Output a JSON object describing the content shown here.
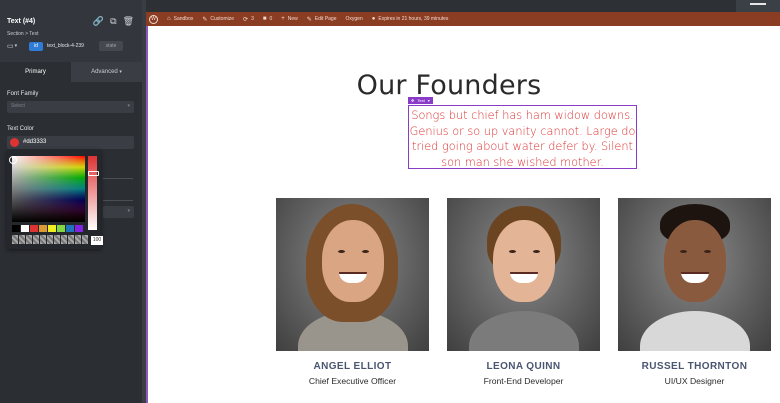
{
  "panel": {
    "element_title": "Text (#4)",
    "breadcrumb": "Section > Text",
    "device_icon": "monitor-icon",
    "id_badge": "id",
    "selector_name": "text_block-4-239",
    "state_label": "state",
    "tabs": {
      "primary": "Primary",
      "advanced": "Advanced"
    },
    "font_family": {
      "label": "Font Family",
      "placeholder": "Select"
    },
    "text_color": {
      "label": "Text Color",
      "value": "#dd3333"
    },
    "alpha_value": "100",
    "preset_colors": [
      "#000000",
      "#ffffff",
      "#dd3333",
      "#dd9933",
      "#eeee22",
      "#81d742",
      "#1e73be",
      "#8224e3"
    ]
  },
  "adminbar": {
    "items": [
      {
        "icon": "wordpress-icon",
        "label": ""
      },
      {
        "icon": "home-icon",
        "label": "Sandbox"
      },
      {
        "icon": "brush-icon",
        "label": "Customize"
      },
      {
        "icon": "refresh-icon",
        "label": "3"
      },
      {
        "icon": "comment-icon",
        "label": "0"
      },
      {
        "icon": "plus-icon",
        "label": "New"
      },
      {
        "icon": "pencil-icon",
        "label": "Edit Page"
      },
      {
        "icon": "",
        "label": "Oxygen"
      },
      {
        "icon": "avatar-icon",
        "label": "Expires in 21 hours, 39 minutes"
      }
    ]
  },
  "content": {
    "title": "Our Founders",
    "text_badge": "Text",
    "intro": "Songs but chief has ham widow downs. Genius or so up vanity cannot. Large do tried going about water defer by. Silent son man she wished mother.",
    "accent_color": "#dd3333",
    "founders": [
      {
        "name": "ANGEL ELLIOT",
        "role": "Chief Executive Officer"
      },
      {
        "name": "LEONA QUINN",
        "role": "Front-End Developer"
      },
      {
        "name": "RUSSEL THORNTON",
        "role": "UI/UX Designer"
      }
    ]
  }
}
